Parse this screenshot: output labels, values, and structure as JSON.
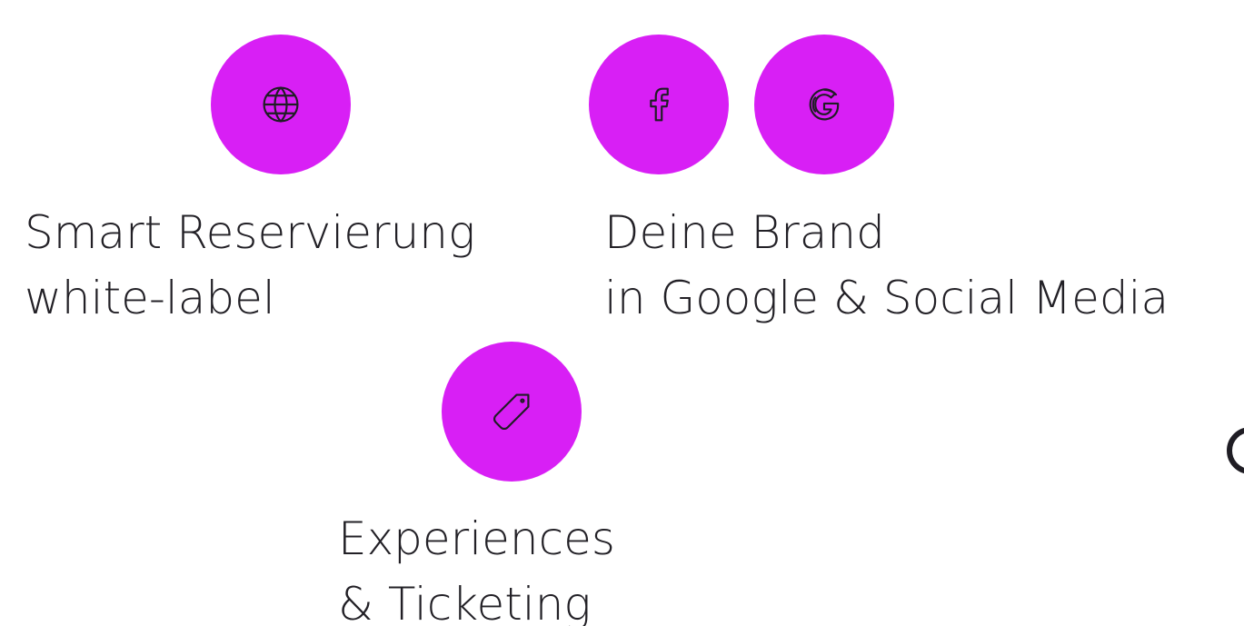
{
  "colors": {
    "accent": "#d81ff5",
    "text": "#222026",
    "icon_stroke": "#1f1d24"
  },
  "features": [
    {
      "name": "smart-reservation",
      "icons": [
        "globe-icon"
      ],
      "lines": [
        "Smart Reservierung",
        "white-label"
      ]
    },
    {
      "name": "brand-google-social",
      "icons": [
        "facebook-icon",
        "google-icon"
      ],
      "lines": [
        "Deine Brand",
        "in Google & Social Media"
      ]
    },
    {
      "name": "experiences-ticketing",
      "icons": [
        "tag-icon"
      ],
      "lines": [
        "Experiences",
        "& Ticketing"
      ]
    }
  ]
}
